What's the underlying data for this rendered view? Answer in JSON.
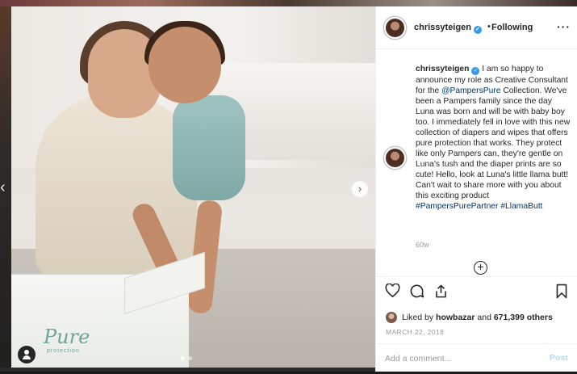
{
  "post": {
    "image_alt": "",
    "box_brand": "Pure",
    "box_sub": "protection"
  },
  "header": {
    "username": "chrissyteigen",
    "bullet": "•",
    "follow_label": "Following",
    "more": "···"
  },
  "caption": {
    "username": "chrissyteigen",
    "text_1": " I am so happy to announce my role as Creative Consultant for the ",
    "mention": "@PampersPure",
    "text_2": " Collection. We've been a Pampers family since the day Luna was born and will be with baby boy too. I immediately fell in love with this new collection of diapers and wipes that offers pure protection that works. They protect like only Pampers can, they're gentle on Luna's tush and the diaper prints are so cute! Hello, look at Luna's little llama butt! Can't wait to share more with you about this exciting product ",
    "hashtag_1": "#PampersPurePartner",
    "hashtag_2": "#LlamaButt",
    "time_ago": "60w",
    "load_more": "+"
  },
  "likes": {
    "prefix": "Liked by ",
    "user": "howbazar",
    "middle": " and ",
    "count": "671,399 others"
  },
  "date": "MARCH 22, 2018",
  "comment": {
    "placeholder": "Add a comment...",
    "post_label": "Post"
  },
  "nav": {
    "prev": "‹",
    "next": "›"
  }
}
